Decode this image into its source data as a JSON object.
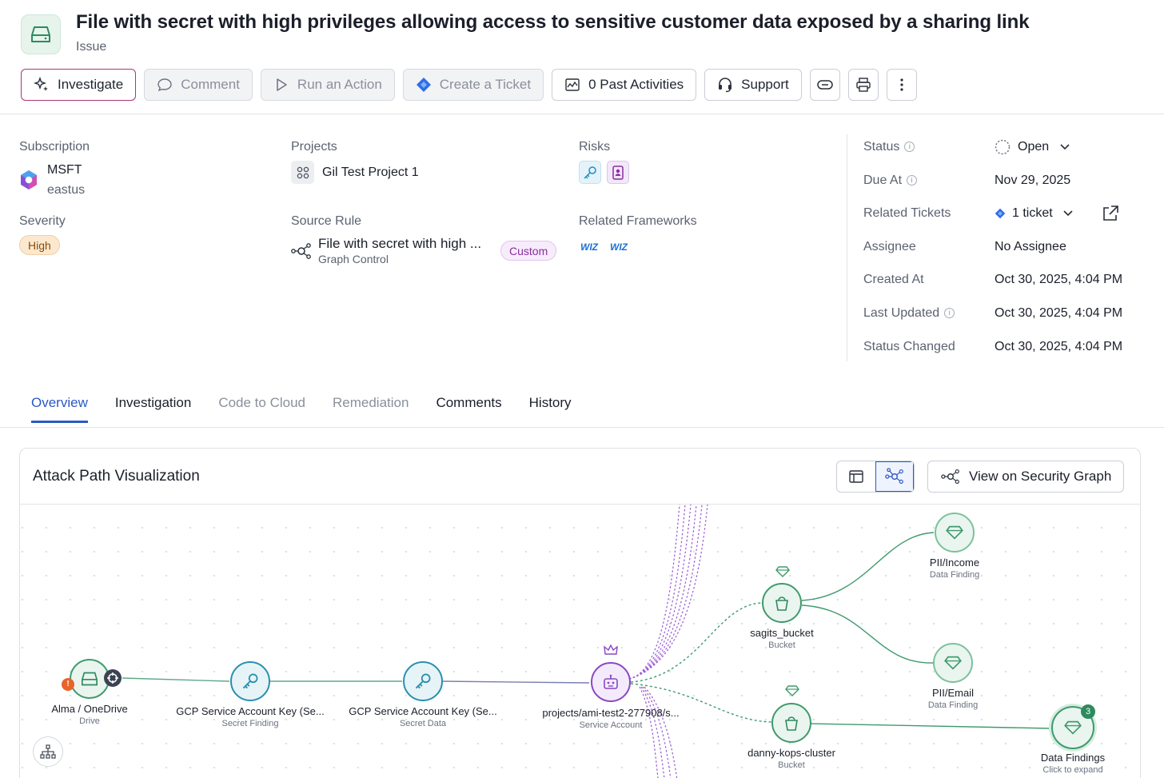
{
  "header": {
    "title": "File with secret with high privileges allowing access to sensitive customer data exposed by a sharing link",
    "subtitle": "Issue",
    "icon": "drive-icon"
  },
  "toolbar": {
    "investigate": "Investigate",
    "comment": "Comment",
    "run_action": "Run an Action",
    "create_ticket": "Create a Ticket",
    "past_activities": "0 Past Activities",
    "support": "Support"
  },
  "details": {
    "subscription_label": "Subscription",
    "subscription_name": "MSFT",
    "subscription_region": "eastus",
    "severity_label": "Severity",
    "severity_value": "High",
    "projects_label": "Projects",
    "project_name": "Gil Test Project 1",
    "source_rule_label": "Source Rule",
    "source_rule_name": "File with secret with high ...",
    "source_rule_type": "Graph Control",
    "source_rule_badge": "Custom",
    "risks_label": "Risks",
    "frameworks_label": "Related Frameworks",
    "framework_logos": [
      "wiz",
      "wiz"
    ]
  },
  "side": {
    "status_label": "Status",
    "status_value": "Open",
    "due_label": "Due At",
    "due_value": "Nov 29, 2025",
    "tickets_label": "Related Tickets",
    "tickets_value": "1 ticket",
    "assignee_label": "Assignee",
    "assignee_value": "No Assignee",
    "created_label": "Created At",
    "created_value": "Oct 30, 2025, 4:04 PM",
    "updated_label": "Last Updated",
    "updated_value": "Oct 30, 2025, 4:04 PM",
    "status_changed_label": "Status Changed",
    "status_changed_value": "Oct 30, 2025, 4:04 PM"
  },
  "tabs": [
    "Overview",
    "Investigation",
    "Code to Cloud",
    "Remediation",
    "Comments",
    "History"
  ],
  "card": {
    "title": "Attack Path Visualization",
    "view_graph_button": "View on Security Graph"
  },
  "graph": {
    "nodes": [
      {
        "label": "Alma / OneDrive",
        "sub": "Drive"
      },
      {
        "label": "GCP Service Account Key (Se...",
        "sub": "Secret Finding"
      },
      {
        "label": "GCP Service Account Key (Se...",
        "sub": "Secret Data"
      },
      {
        "label": "projects/ami-test2-277908/s...",
        "sub": "Service Account"
      },
      {
        "label": "sagits_bucket",
        "sub": "Bucket"
      },
      {
        "label": "danny-kops-cluster",
        "sub": "Bucket"
      },
      {
        "label": "PII/Income",
        "sub": "Data Finding"
      },
      {
        "label": "PII/Email",
        "sub": "Data Finding"
      },
      {
        "label": "Data Findings",
        "sub": "Click to expand",
        "count": "3"
      }
    ]
  },
  "colors": {
    "accent": "#2b59c3",
    "primary_border": "#a8367a",
    "green_node": "#3f9a6d",
    "purple_node": "#8a48c2"
  }
}
